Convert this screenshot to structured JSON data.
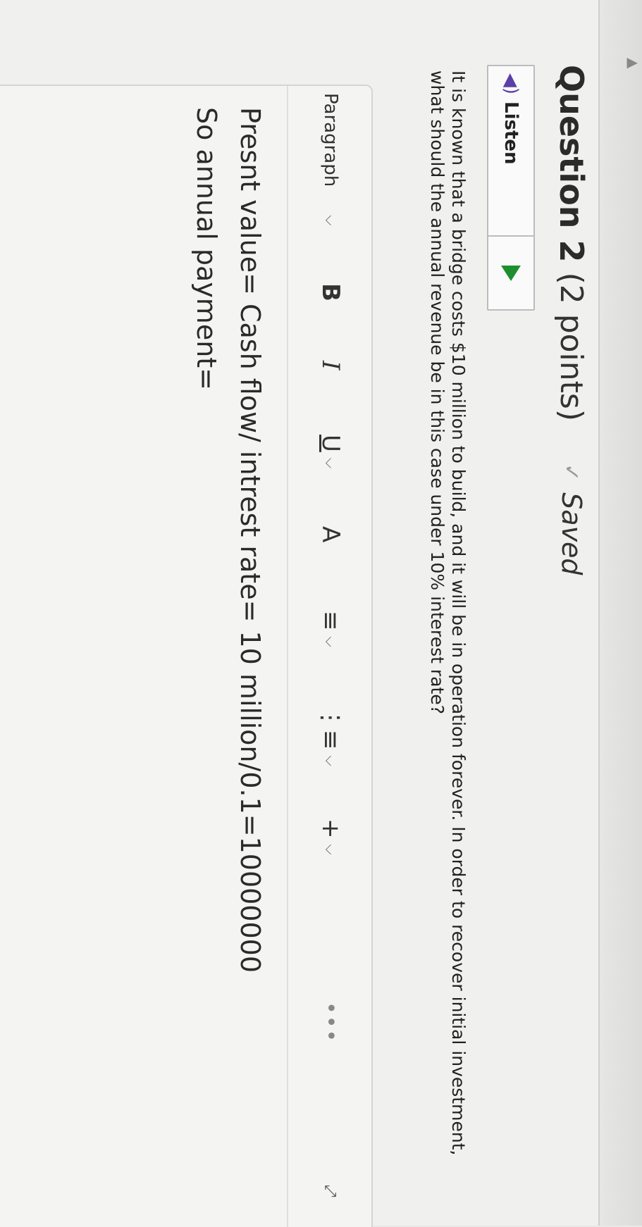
{
  "question": {
    "title": "Question 2",
    "points": "(2 points)",
    "status": "Saved",
    "status_icon": "check-icon",
    "text": "It is known that a bridge costs $10 million to build, and it will be in operation forever. In order to recover initial investment, what should the annual revenue be in this case under 10% interest rate?"
  },
  "listen": {
    "label": "Listen",
    "icon": "speaker-icon",
    "play_icon": "play-icon"
  },
  "toolbar": {
    "paragraph_label": "Paragraph",
    "bold": "B",
    "italic": "I",
    "underline": "U",
    "font_color": "A",
    "align": "≡",
    "list": "⋮≡",
    "insert": "+",
    "more": "•••"
  },
  "answer": {
    "line1": "Presnt value= Cash flow/ intrest rate= 10 million/0.1=10000000",
    "line2": "So annual payment="
  },
  "colors": {
    "play": "#1e8f2e",
    "speaker": "#5b3fa8"
  }
}
